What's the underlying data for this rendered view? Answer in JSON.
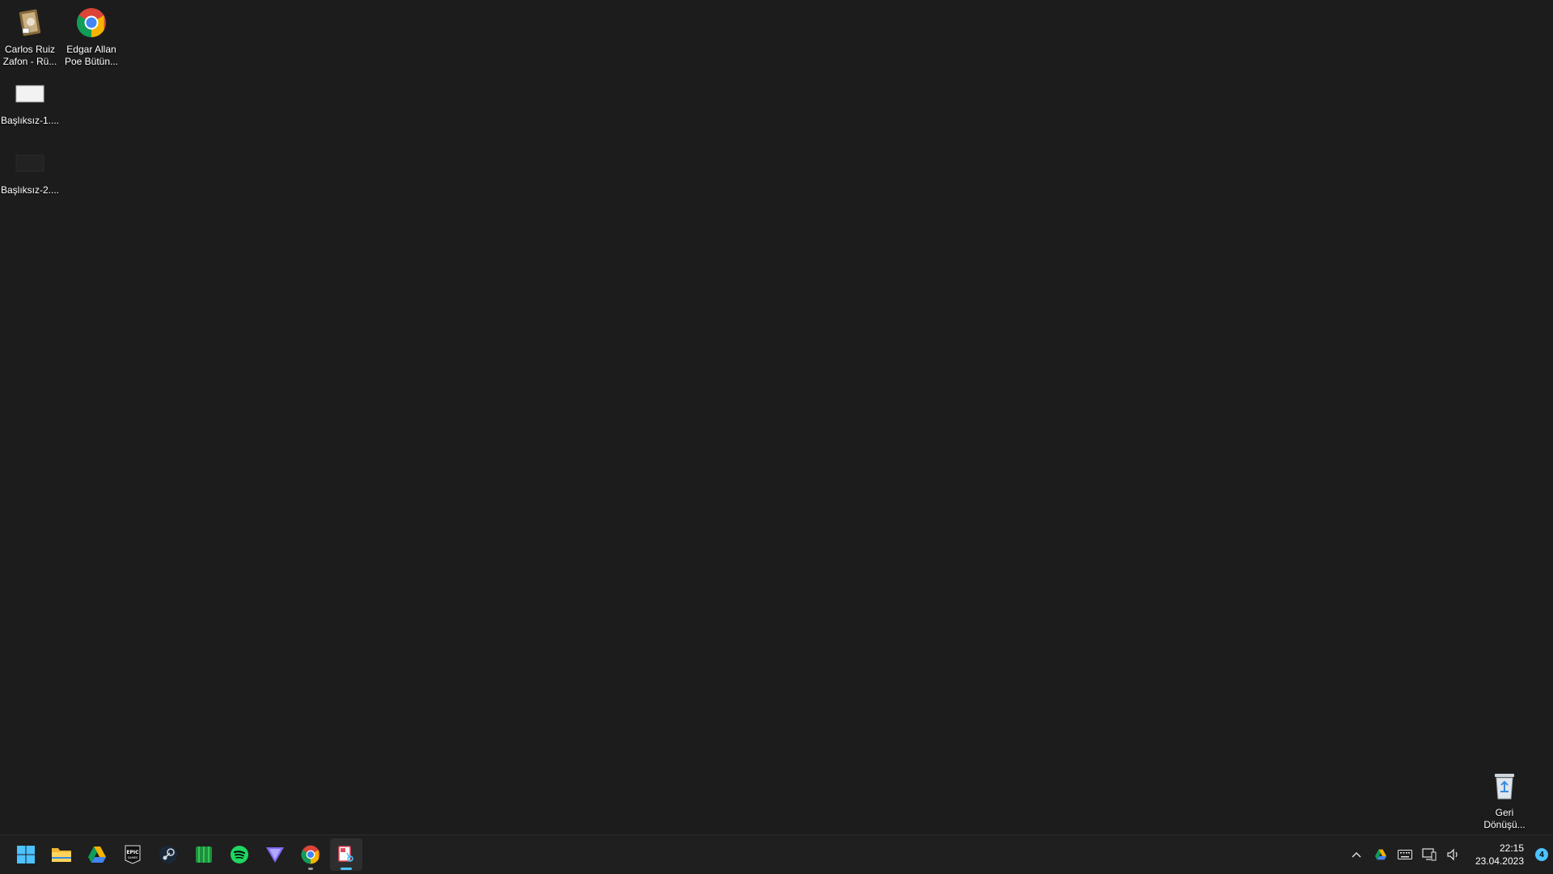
{
  "desktop": {
    "icons": [
      {
        "label": "Carlos Ruiz\nZafon - Rü...",
        "icon": "book-shortcut-icon"
      },
      {
        "label": "Edgar Allan\nPoe Bütün...",
        "icon": "chrome-icon"
      },
      {
        "label": "Başlıksız-1....",
        "icon": "image-file-icon"
      },
      {
        "label": "Başlıksız-2....",
        "icon": "image-file-icon"
      },
      {
        "label": "Geri\nDönüşü...",
        "icon": "recycle-bin-icon"
      }
    ]
  },
  "taskbar": {
    "apps": [
      {
        "name": "Start",
        "icon": "windows-start-icon"
      },
      {
        "name": "File Explorer",
        "icon": "folder-icon"
      },
      {
        "name": "Google Drive",
        "icon": "google-drive-icon"
      },
      {
        "name": "Epic Games",
        "icon": "epic-games-icon"
      },
      {
        "name": "Steam",
        "icon": "steam-icon"
      },
      {
        "name": "Green app",
        "icon": "green-app-icon"
      },
      {
        "name": "Spotify",
        "icon": "spotify-icon"
      },
      {
        "name": "Proton VPN",
        "icon": "vpn-icon"
      },
      {
        "name": "Google Chrome",
        "icon": "chrome-icon"
      },
      {
        "name": "Snipping Tool",
        "icon": "snipping-tool-icon"
      }
    ],
    "tray": {
      "icons": [
        "chevron-up-icon",
        "google-drive-icon",
        "keyboard-icon",
        "network-icon",
        "volume-icon"
      ],
      "time": "22:15",
      "date": "23.04.2023",
      "notification_count": "4"
    }
  },
  "colors": {
    "desktop_bg": "#1c1c1c",
    "taskbar_bg": "#1f1f1f",
    "accent": "#4cc2ff"
  }
}
